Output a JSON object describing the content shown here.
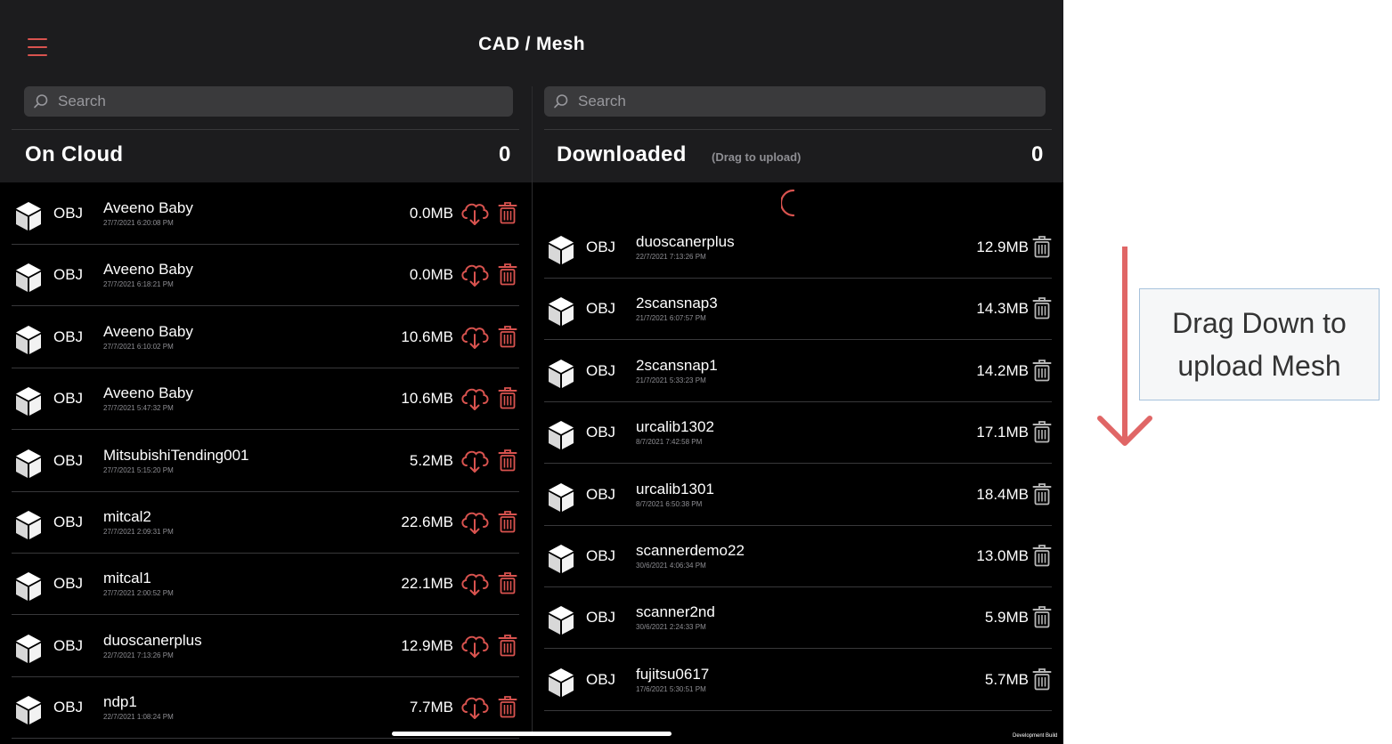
{
  "header": {
    "title": "CAD / Mesh",
    "menu_icon": "hamburger-menu-icon"
  },
  "colors": {
    "accent": "#d9534f",
    "background": "#000000",
    "topbar": "#1c1c1e",
    "arrow": "#e06666"
  },
  "cloud": {
    "search_placeholder": "Search",
    "title": "On Cloud",
    "count": "0",
    "items": [
      {
        "type": "OBJ",
        "name": "Aveeno Baby",
        "date": "27/7/2021 6:20:08 PM",
        "size": "0.0MB"
      },
      {
        "type": "OBJ",
        "name": "Aveeno Baby",
        "date": "27/7/2021 6:18:21 PM",
        "size": "0.0MB"
      },
      {
        "type": "OBJ",
        "name": "Aveeno Baby",
        "date": "27/7/2021 6:10:02 PM",
        "size": "10.6MB"
      },
      {
        "type": "OBJ",
        "name": "Aveeno Baby",
        "date": "27/7/2021 5:47:32 PM",
        "size": "10.6MB"
      },
      {
        "type": "OBJ",
        "name": "MitsubishiTending001",
        "date": "27/7/2021 5:15:20 PM",
        "size": "5.2MB"
      },
      {
        "type": "OBJ",
        "name": "mitcal2",
        "date": "27/7/2021 2:09:31 PM",
        "size": "22.6MB"
      },
      {
        "type": "OBJ",
        "name": "mitcal1",
        "date": "27/7/2021 2:00:52 PM",
        "size": "22.1MB"
      },
      {
        "type": "OBJ",
        "name": "duoscanerplus",
        "date": "22/7/2021 7:13:26 PM",
        "size": "12.9MB"
      },
      {
        "type": "OBJ",
        "name": "ndp1",
        "date": "22/7/2021 1:08:24 PM",
        "size": "7.7MB"
      }
    ]
  },
  "downloaded": {
    "search_placeholder": "Search",
    "title": "Downloaded",
    "hint": "(Drag to upload)",
    "count": "0",
    "items": [
      {
        "type": "OBJ",
        "name": "duoscanerplus",
        "date": "22/7/2021 7:13:26 PM",
        "size": "12.9MB"
      },
      {
        "type": "OBJ",
        "name": "2scansnap3",
        "date": "21/7/2021 6:07:57 PM",
        "size": "14.3MB"
      },
      {
        "type": "OBJ",
        "name": "2scansnap1",
        "date": "21/7/2021 5:33:23 PM",
        "size": "14.2MB"
      },
      {
        "type": "OBJ",
        "name": "urcalib1302",
        "date": "8/7/2021 7:42:58 PM",
        "size": "17.1MB"
      },
      {
        "type": "OBJ",
        "name": "urcalib1301",
        "date": "8/7/2021 6:50:38 PM",
        "size": "18.4MB"
      },
      {
        "type": "OBJ",
        "name": "scannerdemo22",
        "date": "30/6/2021 4:06:34 PM",
        "size": "13.0MB"
      },
      {
        "type": "OBJ",
        "name": "scanner2nd",
        "date": "30/6/2021 2:24:33 PM",
        "size": "5.9MB"
      },
      {
        "type": "OBJ",
        "name": "fujitsu0617",
        "date": "17/6/2021 5:30:51 PM",
        "size": "5.7MB"
      }
    ]
  },
  "footer": {
    "dev_build": "Development Build"
  },
  "annotation": {
    "callout_line1": "Drag Down to",
    "callout_line2": "upload Mesh",
    "arrow_icon": "arrow-down-icon"
  }
}
